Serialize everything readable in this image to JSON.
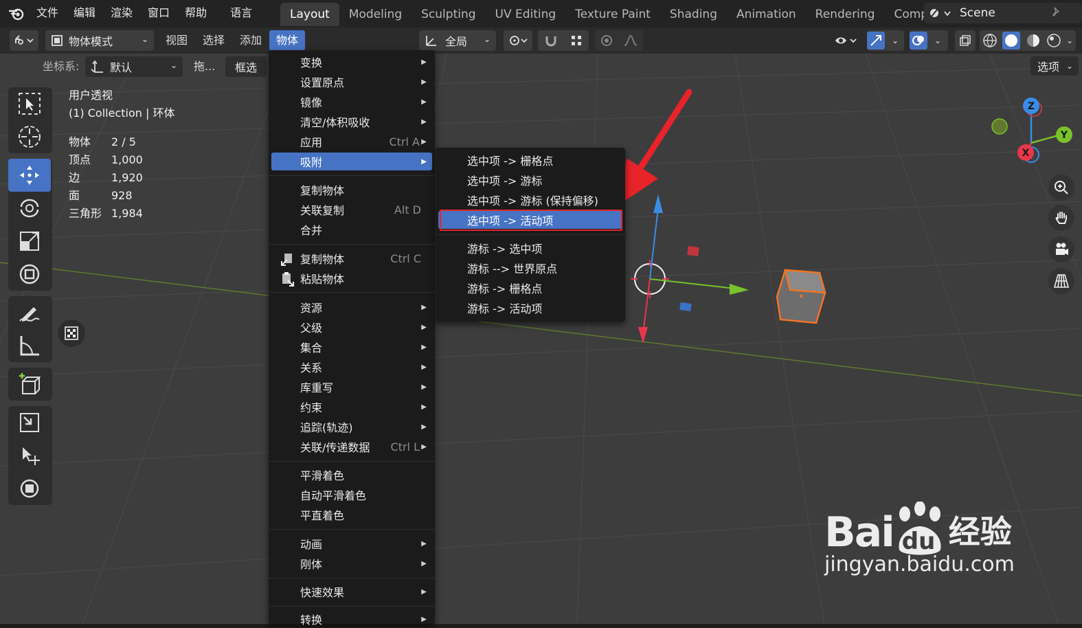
{
  "topbar": {
    "menus": [
      "文件",
      "编辑",
      "渲染",
      "窗口",
      "帮助",
      "语言"
    ],
    "workspaces": [
      "Layout",
      "Modeling",
      "Sculpting",
      "UV Editing",
      "Texture Paint",
      "Shading",
      "Animation",
      "Rendering",
      "Composit"
    ],
    "active_workspace": "Layout",
    "scene": "Scene"
  },
  "header": {
    "mode": "物体模式",
    "menus": [
      "视图",
      "选择",
      "添加",
      "物体"
    ],
    "active_menu": "物体",
    "transform_orientation": "全局"
  },
  "tool_settings": {
    "coord_label": "坐标系:",
    "coord_value": "默认",
    "drag_label": "拖...",
    "box_select": "框选",
    "options": "选项"
  },
  "viewport_info": {
    "view_name": "用户透视",
    "collection": "(1) Collection | 环体",
    "stats": [
      {
        "label": "物体",
        "value": "2 / 5"
      },
      {
        "label": "顶点",
        "value": "1,000"
      },
      {
        "label": "边",
        "value": "1,920"
      },
      {
        "label": "面",
        "value": "928"
      },
      {
        "label": "三角形",
        "value": "1,984"
      }
    ]
  },
  "object_menu": {
    "items": [
      {
        "label": "变换",
        "shortcut": "",
        "submenu": true
      },
      {
        "label": "设置原点",
        "shortcut": "",
        "submenu": true
      },
      {
        "label": "镜像",
        "shortcut": "",
        "submenu": true
      },
      {
        "label": "清空/体积吸收",
        "shortcut": "",
        "submenu": true
      },
      {
        "label": "应用",
        "shortcut": "Ctrl A",
        "submenu": true
      },
      {
        "label": "吸附",
        "shortcut": "",
        "submenu": true
      },
      {
        "label": "复制物体",
        "shortcut": "",
        "submenu": false
      },
      {
        "label": "关联复制",
        "shortcut": "Alt D",
        "submenu": false
      },
      {
        "label": "合并",
        "shortcut": "",
        "submenu": false
      },
      {
        "label": "复制物体",
        "shortcut": "Ctrl C",
        "submenu": false
      },
      {
        "label": "粘贴物体",
        "shortcut": "",
        "submenu": false
      },
      {
        "label": "资源",
        "shortcut": "",
        "submenu": true
      },
      {
        "label": "父级",
        "shortcut": "",
        "submenu": true
      },
      {
        "label": "集合",
        "shortcut": "",
        "submenu": true
      },
      {
        "label": "关系",
        "shortcut": "",
        "submenu": true
      },
      {
        "label": "库重写",
        "shortcut": "",
        "submenu": true
      },
      {
        "label": "约束",
        "shortcut": "",
        "submenu": true
      },
      {
        "label": "追踪(轨迹)",
        "shortcut": "",
        "submenu": true
      },
      {
        "label": "关联/传递数据",
        "shortcut": "Ctrl L",
        "submenu": true
      },
      {
        "label": "平滑着色",
        "shortcut": "",
        "submenu": false
      },
      {
        "label": "自动平滑着色",
        "shortcut": "",
        "submenu": false
      },
      {
        "label": "平直着色",
        "shortcut": "",
        "submenu": false
      },
      {
        "label": "动画",
        "shortcut": "",
        "submenu": true
      },
      {
        "label": "刚体",
        "shortcut": "",
        "submenu": true
      },
      {
        "label": "快速效果",
        "shortcut": "",
        "submenu": true
      },
      {
        "label": "转换",
        "shortcut": "",
        "submenu": true
      }
    ]
  },
  "snap_submenu": {
    "items": [
      "选中项 -> 栅格点",
      "选中项 -> 游标",
      "选中项 -> 游标 (保持偏移)",
      "选中项 -> 活动项",
      "游标 -> 选中项",
      "游标 --> 世界原点",
      "游标 -> 栅格点",
      "游标 -> 活动项"
    ],
    "highlighted": "选中项 -> 活动项"
  },
  "nav_gizmo": {
    "x": "X",
    "y": "Y",
    "z": "Z"
  },
  "watermark": {
    "main": "Bai",
    "paw_text": "du",
    "suffix": "经验",
    "url": "jingyan.baidu.com"
  },
  "colors": {
    "accent": "#4773c4",
    "x_axis": "#e8374c",
    "y_axis": "#7ac22b",
    "z_axis": "#3a8de6",
    "annotation_red": "#e8232a",
    "selected_outline": "#f07526"
  }
}
